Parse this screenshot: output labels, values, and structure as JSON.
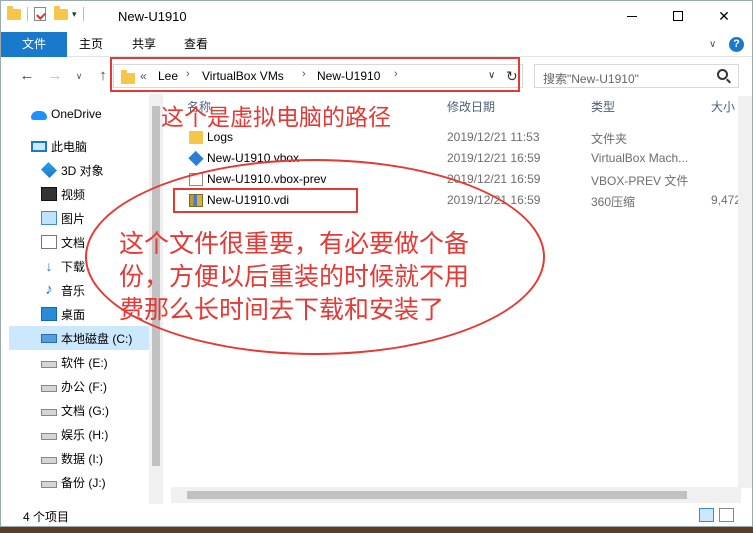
{
  "window": {
    "title": "New-U1910",
    "controls": {
      "minimize": "minimize",
      "maximize": "maximize",
      "close": "✕"
    }
  },
  "ribbon": {
    "tabs": [
      "文件",
      "主页",
      "共享",
      "查看"
    ],
    "expand_glyph": "∨",
    "help_glyph": "?",
    "accent_color": "#1979ca"
  },
  "nav": {
    "back": "←",
    "forward": "→",
    "recent": "∨",
    "up": "↑",
    "breadcrumb": [
      "«",
      "Lee",
      "VirtualBox VMs",
      "New-U1910"
    ],
    "breadcrumb_sep": "›",
    "dropdown": "∨",
    "refresh": "↻",
    "search_placeholder": "搜索\"New-U1910\""
  },
  "sidebar": {
    "items": [
      {
        "label": "OneDrive",
        "icon": "cloud-icon"
      },
      {
        "label": "此电脑",
        "icon": "computer-icon"
      },
      {
        "label": "3D 对象",
        "icon": "3d-objects-icon"
      },
      {
        "label": "视频",
        "icon": "video-icon"
      },
      {
        "label": "图片",
        "icon": "pictures-icon"
      },
      {
        "label": "文档",
        "icon": "documents-icon"
      },
      {
        "label": "下载",
        "icon": "download-icon"
      },
      {
        "label": "音乐",
        "icon": "music-icon"
      },
      {
        "label": "桌面",
        "icon": "desktop-icon"
      },
      {
        "label": "本地磁盘 (C:)",
        "icon": "system-drive-icon",
        "selected": true
      },
      {
        "label": "软件 (E:)",
        "icon": "drive-icon"
      },
      {
        "label": "办公 (F:)",
        "icon": "drive-icon"
      },
      {
        "label": "文档 (G:)",
        "icon": "drive-icon"
      },
      {
        "label": "娱乐 (H:)",
        "icon": "drive-icon"
      },
      {
        "label": "数据 (I:)",
        "icon": "drive-icon"
      },
      {
        "label": "备份 (J:)",
        "icon": "drive-icon"
      }
    ]
  },
  "columns": {
    "name": "名称",
    "date": "修改日期",
    "type": "类型",
    "size": "大小"
  },
  "files": [
    {
      "name": "Logs",
      "date": "2019/12/21 11:53",
      "type": "文件夹",
      "size": "",
      "icon": "folder-icon"
    },
    {
      "name": "New-U1910.vbox",
      "date": "2019/12/21 16:59",
      "type": "VirtualBox Mach...",
      "size": "",
      "icon": "virtualbox-icon"
    },
    {
      "name": "New-U1910.vbox-prev",
      "date": "2019/12/21 16:59",
      "type": "VBOX-PREV 文件",
      "size": "",
      "icon": "file-icon"
    },
    {
      "name": "New-U1910.vdi",
      "date": "2019/12/21 16:59",
      "type": "360压缩",
      "size": "9,472,",
      "icon": "archive-icon"
    }
  ],
  "status": {
    "count": "4 个项目"
  },
  "annotations": {
    "path_note": "这个是虚拟电脑的路径",
    "file_note_lines": [
      "这个文件很重要，有必要做个备",
      "份，方便以后重装的时候就不用",
      "费那么长时间去下载和安装了"
    ],
    "color": "#e53935"
  }
}
